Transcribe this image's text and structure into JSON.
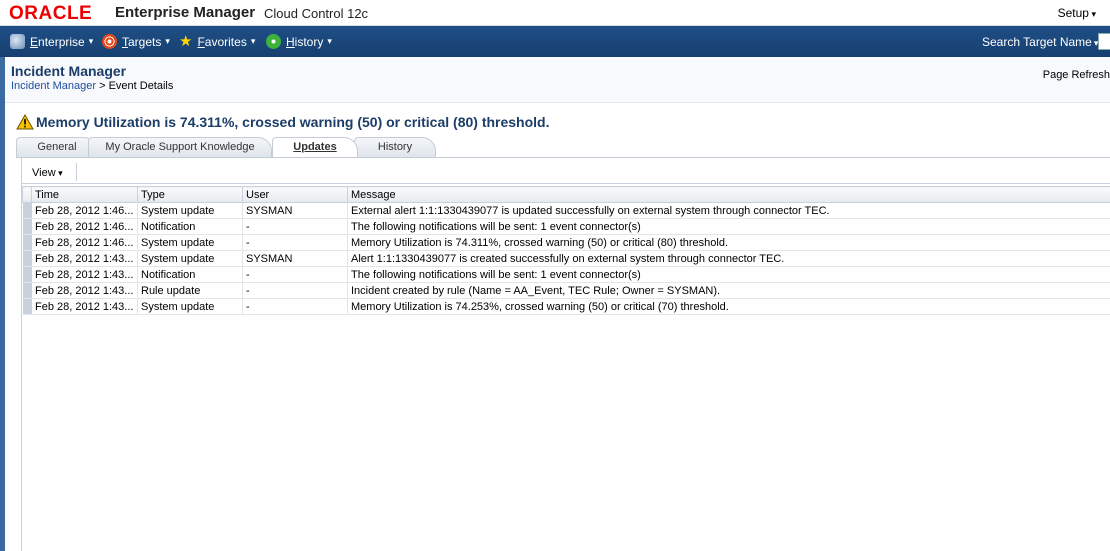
{
  "header": {
    "brand": "ORACLE",
    "product": "Enterprise Manager",
    "edition": "Cloud Control 12c",
    "setup_label": "Setup"
  },
  "nav": {
    "items": [
      {
        "label": "Enterprise",
        "icon": "enterprise-icon"
      },
      {
        "label": "Targets",
        "icon": "target-icon"
      },
      {
        "label": "Favorites",
        "icon": "star-icon"
      },
      {
        "label": "History",
        "icon": "clock-icon"
      }
    ],
    "search_label": "Search Target Name"
  },
  "page": {
    "title": "Incident Manager",
    "breadcrumb_link": "Incident Manager",
    "breadcrumb_sep": ">",
    "breadcrumb_current": "Event Details",
    "refresh_label": "Page Refresh"
  },
  "event": {
    "title": "Memory Utilization is 74.311%, crossed warning (50) or critical (80) threshold."
  },
  "tabs": [
    {
      "label": "General"
    },
    {
      "label": "My Oracle Support Knowledge"
    },
    {
      "label": "Updates"
    },
    {
      "label": "History"
    }
  ],
  "toolbar": {
    "view_label": "View"
  },
  "table": {
    "columns": [
      "Time",
      "Type",
      "User",
      "Message"
    ],
    "rows": [
      [
        "Feb 28, 2012 1:46...",
        "System update",
        "SYSMAN",
        "External alert 1:1:1330439077 is updated successfully on external system through connector TEC."
      ],
      [
        "Feb 28, 2012 1:46...",
        "Notification",
        "-",
        "The following notifications will be sent: 1 event connector(s)"
      ],
      [
        "Feb 28, 2012 1:46...",
        "System update",
        "-",
        "Memory Utilization is 74.311%, crossed warning (50) or critical (80) threshold."
      ],
      [
        "Feb 28, 2012 1:43...",
        "System update",
        "SYSMAN",
        "Alert 1:1:1330439077 is created successfully on external system through connector TEC."
      ],
      [
        "Feb 28, 2012 1:43...",
        "Notification",
        "-",
        "The following notifications will be sent: 1 event connector(s)"
      ],
      [
        "Feb 28, 2012 1:43...",
        "Rule update",
        "-",
        "Incident created by rule (Name = AA_Event, TEC Rule; Owner = SYSMAN)."
      ],
      [
        "Feb 28, 2012 1:43...",
        "System update",
        "-",
        "Memory Utilization is 74.253%, crossed warning (50) or critical (70) threshold."
      ]
    ]
  },
  "colors": {
    "nav_bg": "#1f4f86",
    "brand_red": "#ee0000",
    "title_blue": "#1b3d67",
    "link_blue": "#1c4f9c"
  }
}
